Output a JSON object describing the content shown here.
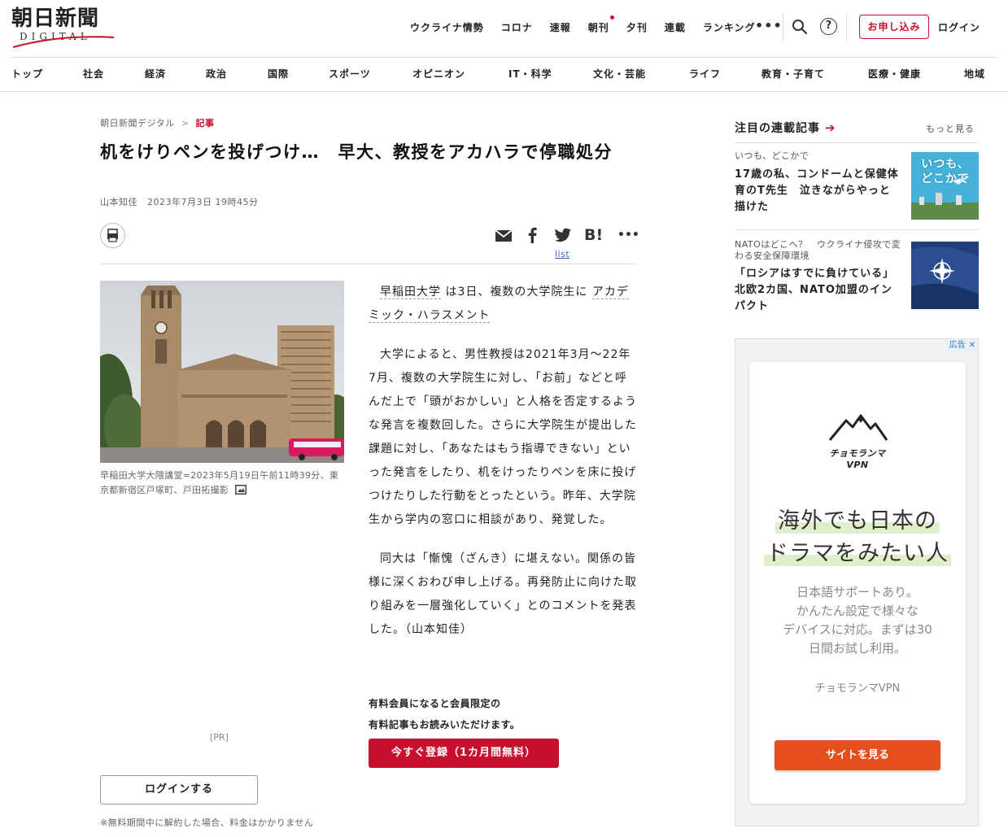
{
  "header": {
    "logo_main": "朝日新聞",
    "logo_sub": "DIGITAL",
    "topnav": [
      {
        "label": "ウクライナ情勢"
      },
      {
        "label": "コロナ"
      },
      {
        "label": "速報"
      },
      {
        "label": "朝刊",
        "has_dot": true
      },
      {
        "label": "夕刊"
      },
      {
        "label": "連載"
      },
      {
        "label": "ランキング"
      }
    ],
    "more_label": "•••",
    "help_label": "?",
    "subscribe_label": "お申し込み",
    "login_label": "ログイン",
    "accent_color": "#c8102e"
  },
  "categories": [
    "トップ",
    "社会",
    "経済",
    "政治",
    "国際",
    "スポーツ",
    "オピニオン",
    "IT・科学",
    "文化・芸能",
    "ライフ",
    "教育・子育て",
    "医療・健康",
    "地域"
  ],
  "article": {
    "breadcrumb": {
      "home": "朝日新聞デジタル",
      "sep": ">",
      "current": "記事"
    },
    "title": "机をけりペンを投げつけ…　早大、教授をアカハラで停職処分",
    "author": "山本知佳",
    "datetime": "2023年7月3日 19時45分",
    "share_list_label": "list",
    "share_hatena": "B!",
    "share_more": "•••",
    "photo_caption": "早稲田大学大隈講堂=2023年5月19日午前11時39分、東京都新宿区戸塚町、戸田拓撮影",
    "pr_label": "[PR]",
    "p1": {
      "link1": "早稲田大学",
      "mid": "は3日、複数の大学院生に",
      "link2": "アカデミック・ハラスメント"
    },
    "p2": "大学によると、男性教授は2021年3月～22年7月、複数の大学院生に対し、「お前」などと呼んだ上で「頭がおかしい」と人格を否定するような発言を複数回した。さらに大学院生が提出した課題に対し、「あなたはもう指導できない」といった発言をしたり、机をけったりペンを床に投げつけたりした行動をとったという。昨年、大学院生から学内の窓口に相談があり、発覚した。",
    "p3": "同大は「慚愧（ざんき）に堪えない。関係の皆様に深くおわび申し上げる。再発防止に向けた取り組みを一層強化していく」とのコメントを発表した。（山本知佳）",
    "member_line1": "有料会員になると会員限定の",
    "member_line2": "有料記事もお読みいただけます。",
    "register_label": "今すぐ登録（1カ月間無料）",
    "login_label": "ログインする",
    "note": "※無料期間中に解約した場合、料金はかかりません"
  },
  "sidebar": {
    "heading": "注目の連載記事",
    "heading_arrow": "➔",
    "more_label": "もっと見る",
    "items": [
      {
        "series": "いつも、どこかで",
        "title": "17歳の私、コンドームと保健体育のT先生　泣きながらやっと描けた",
        "thumb_text": "いつも、どこかで"
      },
      {
        "series": "NATOはどこへ？　ウクライナ侵攻で変わる安全保障環境",
        "title": "「ロシアはすでに負けている」北欧2カ国、NATO加盟のインパクト"
      }
    ]
  },
  "ad": {
    "badge": "広告",
    "close": "✕",
    "brand_logo": "チョモランマ",
    "brand_sub": "VPN",
    "headline_1": "海外でも日本の",
    "headline_2": "ドラマをみたい人",
    "copy": [
      "日本語サポートあり。",
      "かんたん設定で様々な",
      "デバイスに対応。まずは30",
      "日間お試し利用。"
    ],
    "name": "チョモランマVPN",
    "cta": "サイトを見る",
    "cta_color": "#e84e1b"
  }
}
